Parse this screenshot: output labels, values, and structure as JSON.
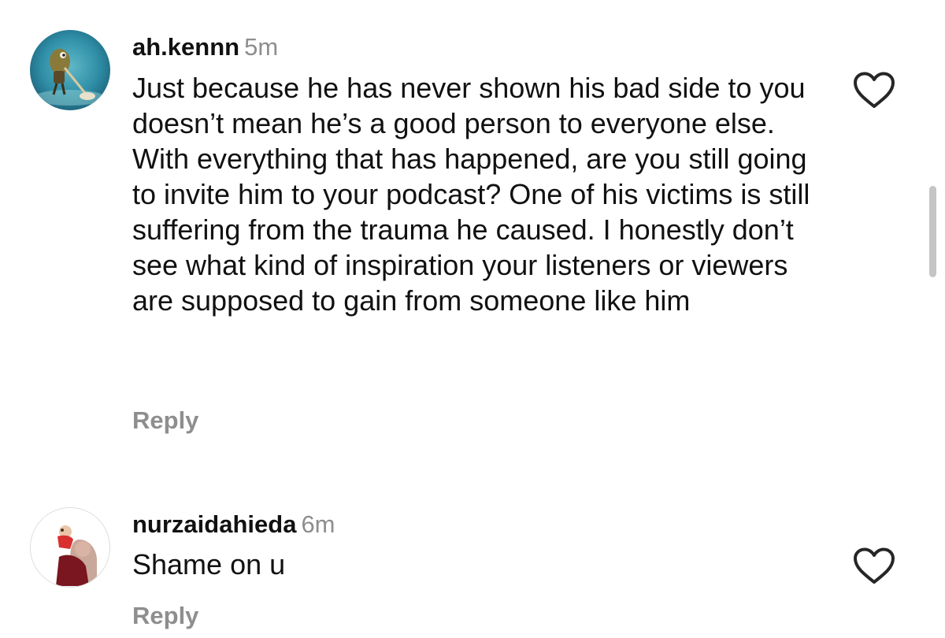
{
  "comments": [
    {
      "username": "ah.kennn",
      "time": "5m",
      "text": "Just because he has never shown his bad side to you doesn’t mean he’s a good person to everyone else. With everything that has happened, are you still going to invite him to your podcast? One of his victims is still suffering from the trauma he caused. I honestly don’t see what kind of inspiration your listeners or viewers are supposed to gain from someone like him",
      "reply_label": "Reply",
      "like_icon": "heart-outline-icon",
      "avatar": "cartoon-character-avatar"
    },
    {
      "username": "nurzaidahieda",
      "time": "6m",
      "text": "Shame on u",
      "reply_label": "Reply",
      "like_icon": "heart-outline-icon",
      "avatar": "family-photo-avatar"
    }
  ],
  "colors": {
    "text": "#111111",
    "secondary": "#8e8e8e",
    "scrollbar": "#c5c5c5"
  }
}
